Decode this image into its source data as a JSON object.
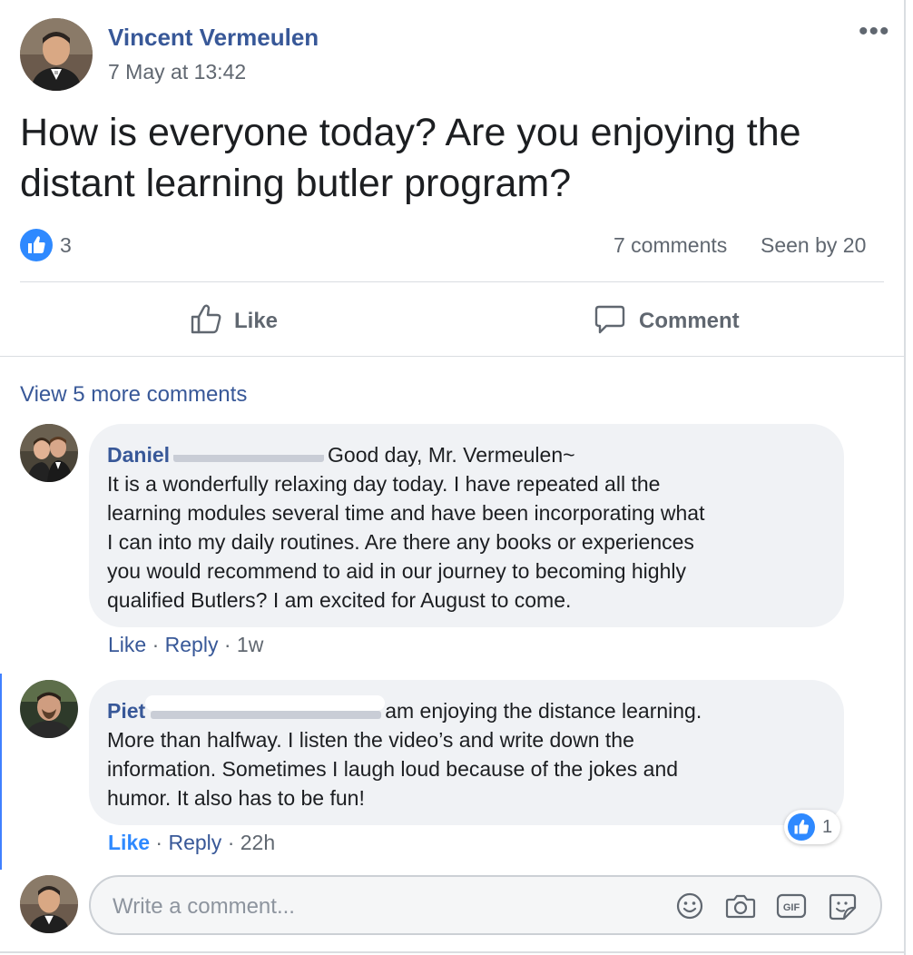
{
  "post": {
    "author": "Vincent Vermeulen",
    "timestamp": "7 May at 13:42",
    "more_label": "•••",
    "text": "How is everyone today? Are you enjoying the distant learning butler program?",
    "like_count": "3",
    "comments_count": "7 comments",
    "seen_by": "Seen by 20",
    "like_label": "Like",
    "comment_label": "Comment"
  },
  "view_more": "View 5 more comments",
  "comments": [
    {
      "name": "Daniel",
      "first_line": "Good day, Mr. Vermeulen~",
      "lines": [
        "It is a wonderfully relaxing day today. I have repeated all the",
        "learning modules several time and have been incorporating what",
        "I can into my daily routines. Are there any books or experiences",
        "you would recommend to aid in our journey to becoming highly",
        "qualified Butlers? I am excited for August to come."
      ],
      "like": "Like",
      "sep": "·",
      "reply": "Reply",
      "time": "1w"
    },
    {
      "name": "Piet",
      "first_line": "am enjoying the distance learning.",
      "lines": [
        "More than halfway. I listen the video’s and write down the",
        "information. Sometimes I laugh loud because of the jokes and",
        "humor. It also has to be fun!"
      ],
      "like": "Like",
      "sep": "·",
      "reply": "Reply",
      "time": "22h",
      "reaction_count": "1"
    }
  ],
  "composer": {
    "placeholder": "Write a comment..."
  },
  "icons": [
    "thumbs-up-icon",
    "speech-bubble-icon",
    "emoji-icon",
    "camera-icon",
    "gif-icon",
    "sticker-icon"
  ],
  "colors": {
    "link": "#385898",
    "like_blue": "#2e89ff",
    "bubble": "#f0f2f5"
  }
}
